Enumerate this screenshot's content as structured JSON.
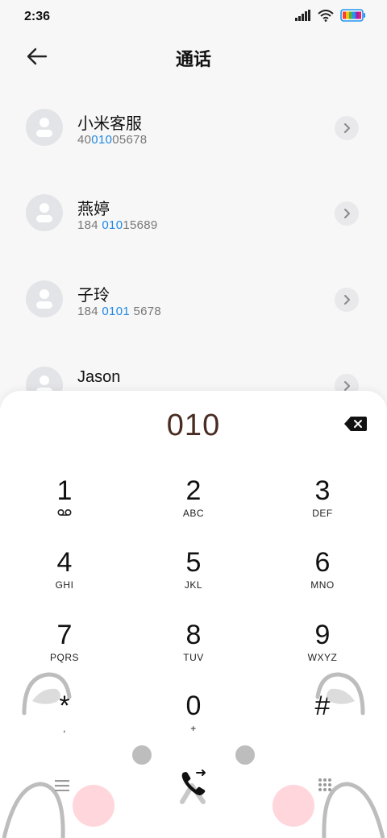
{
  "status": {
    "time": "2:36"
  },
  "header": {
    "title": "通话"
  },
  "contacts": [
    {
      "name": "小米客服",
      "number_pre": "40",
      "number_hl": "010",
      "number_post": "05678"
    },
    {
      "name": "燕婷",
      "number_pre": "184 ",
      "number_hl": "010",
      "number_post": "15689"
    },
    {
      "name": "子玲",
      "number_pre": "184 ",
      "number_hl": "0101",
      "number_post": " 5678"
    },
    {
      "name": "Jason",
      "number_pre": "",
      "number_hl": "",
      "number_post": ""
    }
  ],
  "dialpad": {
    "input": "010",
    "keys": [
      {
        "digit": "1",
        "letters": ""
      },
      {
        "digit": "2",
        "letters": "ABC"
      },
      {
        "digit": "3",
        "letters": "DEF"
      },
      {
        "digit": "4",
        "letters": "GHI"
      },
      {
        "digit": "5",
        "letters": "JKL"
      },
      {
        "digit": "6",
        "letters": "MNO"
      },
      {
        "digit": "7",
        "letters": "PQRS"
      },
      {
        "digit": "8",
        "letters": "TUV"
      },
      {
        "digit": "9",
        "letters": "WXYZ"
      },
      {
        "digit": "*",
        "letters": ","
      },
      {
        "digit": "0",
        "letters": "+"
      },
      {
        "digit": "#",
        "letters": ""
      }
    ]
  },
  "icons": {
    "back": "arrow-left-icon",
    "detail": "chevron-right-icon",
    "delete": "backspace-icon",
    "voicemail": "voicemail-icon",
    "menu": "menu-icon",
    "call": "phone-icon",
    "keypad": "keypad-icon"
  },
  "colors": {
    "accent": "#1e88e5",
    "dial_text": "#4a2c22",
    "blush": "#ffd6dc"
  }
}
